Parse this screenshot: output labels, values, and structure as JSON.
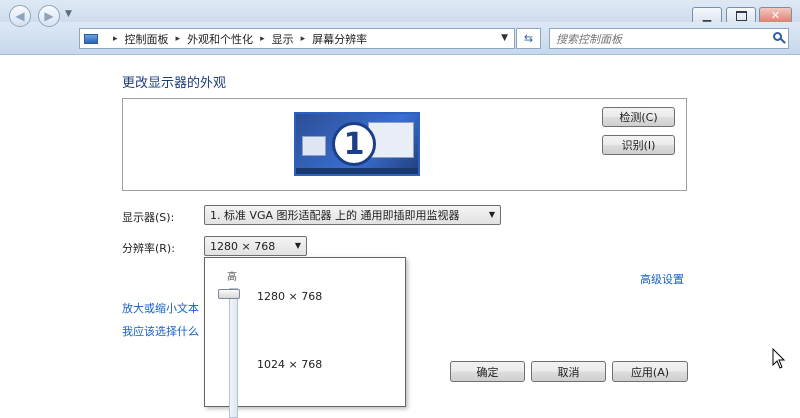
{
  "address": {
    "crumbs": [
      "控制面板",
      "外观和个性化",
      "显示",
      "屏幕分辨率"
    ]
  },
  "search": {
    "placeholder": "搜索控制面板"
  },
  "page": {
    "title": "更改显示器的外观"
  },
  "preview": {
    "monitor_number": "1"
  },
  "buttons": {
    "detect": "检测(C)",
    "identify": "识别(I)",
    "ok": "确定",
    "cancel": "取消",
    "apply": "应用(A)"
  },
  "display": {
    "label": "显示器(S):",
    "value": "1. 标准 VGA 图形适配器 上的 通用即插即用监视器"
  },
  "resolution": {
    "label": "分辨率(R):",
    "value": "1280 × 768"
  },
  "links": {
    "advanced": "高级设置",
    "text_size": "放大或缩小文本",
    "which_settings": "我应该选择什么"
  },
  "dropdown": {
    "high_label": "高",
    "options": [
      "1280 × 768",
      "1024 × 768"
    ],
    "selected": "1280 × 768"
  }
}
